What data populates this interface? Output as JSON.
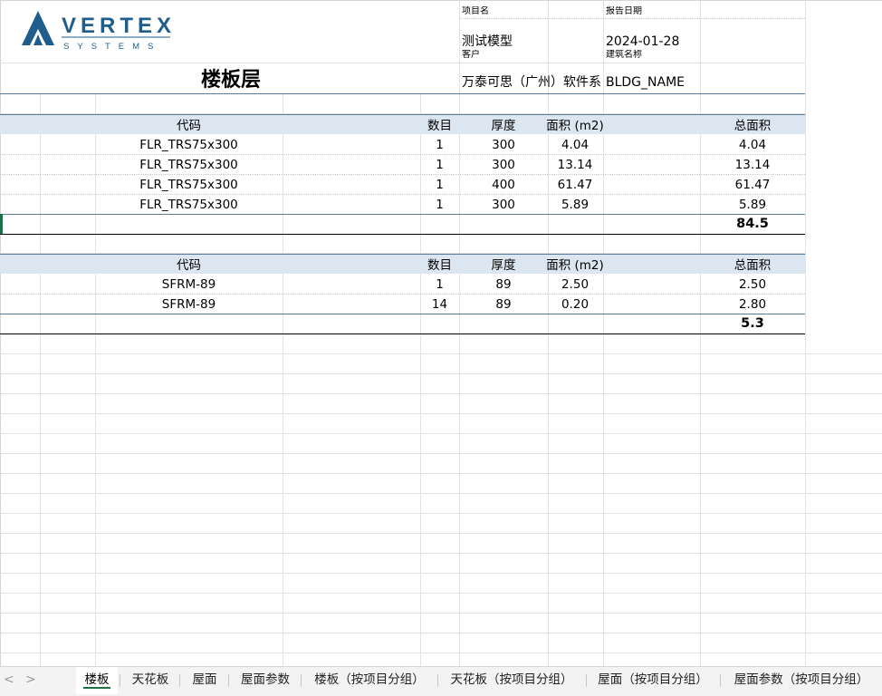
{
  "logo": {
    "word": "VERTEX",
    "sub": "SYSTEMS"
  },
  "header": {
    "project_label": "项目名",
    "project_value": "测试模型",
    "date_label": "报告日期",
    "date_value": "2024-01-28",
    "client_label": "客户",
    "client_value": "万泰可思（广州）软件系",
    "building_label": "建筑名称",
    "building_value": "BLDG_NAME",
    "title": "楼板层"
  },
  "columns": {
    "code": "代码",
    "count": "数目",
    "thickness": "厚度",
    "area": "面积 (m2)",
    "total_area": "总面积"
  },
  "group1": {
    "rows": [
      {
        "code": "FLR_TRS75x300",
        "count": "1",
        "thickness": "300",
        "area": "4.04",
        "total": "4.04"
      },
      {
        "code": "FLR_TRS75x300",
        "count": "1",
        "thickness": "300",
        "area": "13.14",
        "total": "13.14"
      },
      {
        "code": "FLR_TRS75x300",
        "count": "1",
        "thickness": "400",
        "area": "61.47",
        "total": "61.47"
      },
      {
        "code": "FLR_TRS75x300",
        "count": "1",
        "thickness": "300",
        "area": "5.89",
        "total": "5.89"
      }
    ],
    "sum": "84.5"
  },
  "group2": {
    "rows": [
      {
        "code": "SFRM-89",
        "count": "1",
        "thickness": "89",
        "area": "2.50",
        "total": "2.50"
      },
      {
        "code": "SFRM-89",
        "count": "14",
        "thickness": "89",
        "area": "0.20",
        "total": "2.80"
      }
    ],
    "sum": "5.3"
  },
  "tabs": {
    "prev": "<",
    "next": ">",
    "items": [
      {
        "label": "楼板"
      },
      {
        "label": "天花板"
      },
      {
        "label": "屋面"
      },
      {
        "label": "屋面参数"
      },
      {
        "label": "楼板（按项目分组）"
      },
      {
        "label": "天花板（按项目分组）"
      },
      {
        "label": "屋面（按项目分组）"
      },
      {
        "label": "屋面参数（按项目分组）"
      }
    ]
  },
  "colors": {
    "accent": "#1e7145",
    "header_band": "#dce6f1",
    "logo_blue": "#1f5e8c"
  }
}
